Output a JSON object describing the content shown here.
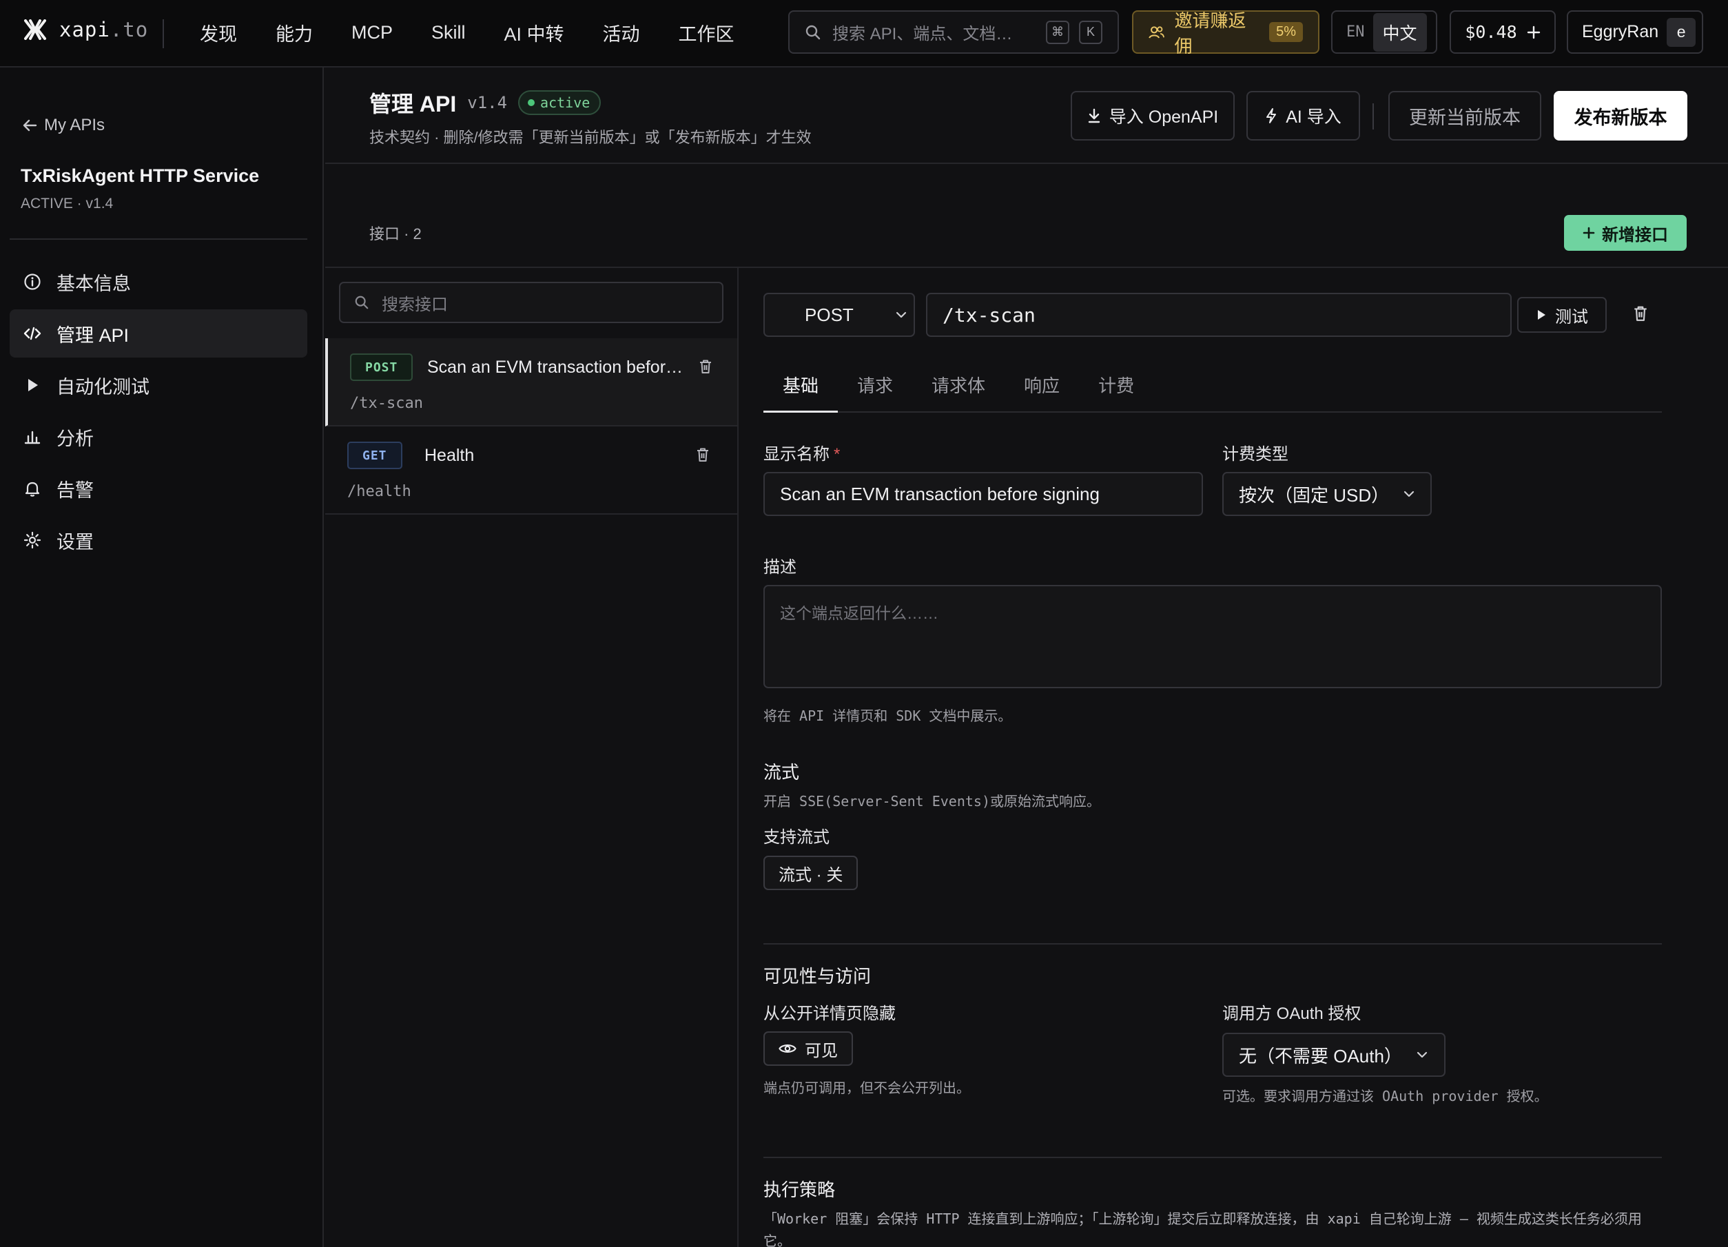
{
  "topbar": {
    "logo": "xapi",
    "logo_suffix": ".to",
    "nav": [
      "发现",
      "能力",
      "MCP",
      "Skill",
      "AI 中转",
      "活动",
      "工作区"
    ],
    "search_placeholder": "搜索 API、端点、文档…",
    "search_shortcut": [
      "⌘",
      "K"
    ],
    "invite_label": "邀请赚返佣",
    "invite_pct": "5%",
    "lang_en": "EN",
    "lang_zh": "中文",
    "balance": "$0.48",
    "username": "EggryRan",
    "avatar_letter": "e"
  },
  "sidebar": {
    "back_label": "My APIs",
    "service_name": "TxRiskAgent HTTP Service",
    "service_sub": "ACTIVE · v1.4",
    "items": [
      {
        "label": "基本信息",
        "icon": "info-icon"
      },
      {
        "label": "管理 API",
        "icon": "code-icon"
      },
      {
        "label": "自动化测试",
        "icon": "play-icon"
      },
      {
        "label": "分析",
        "icon": "bar-chart-icon"
      },
      {
        "label": "告警",
        "icon": "bell-icon"
      },
      {
        "label": "设置",
        "icon": "gear-icon"
      }
    ],
    "active_index": 1
  },
  "header": {
    "title": "管理 API",
    "version": "v1.4",
    "status": "active",
    "subtitle": "技术契约 · 删除/修改需「更新当前版本」或「发布新版本」才生效",
    "import_openapi": "导入 OpenAPI",
    "ai_import": "AI 导入",
    "update_current": "更新当前版本",
    "publish_new": "发布新版本"
  },
  "endpoints": {
    "count_label": "接口 · 2",
    "add_label": "新增接口",
    "search_placeholder": "搜索接口",
    "list": [
      {
        "method": "POST",
        "name": "Scan an EVM transaction before signing",
        "path": "/tx-scan"
      },
      {
        "method": "GET",
        "name": "Health",
        "path": "/health"
      }
    ],
    "selected_index": 0
  },
  "detail": {
    "method": "POST",
    "path": "/tx-scan",
    "test_label": "测试",
    "tabs": [
      "基础",
      "请求",
      "请求体",
      "响应",
      "计费"
    ],
    "active_tab": 0,
    "display_name_label": "显示名称",
    "required_mark": "*",
    "display_name_value": "Scan an EVM transaction before signing",
    "billing_type_label": "计费类型",
    "billing_type_value": "按次（固定 USD）",
    "description_label": "描述",
    "description_placeholder": "这个端点返回什么……",
    "description_hint": "将在 API 详情页和 SDK 文档中展示。",
    "stream_title": "流式",
    "stream_desc": "开启 SSE(Server-Sent Events)或原始流式响应。",
    "stream_support_label": "支持流式",
    "stream_toggle": "流式 · 关",
    "visibility_title": "可见性与访问",
    "hide_label": "从公开详情页隐藏",
    "visible_toggle": "可见",
    "hide_hint": "端点仍可调用，但不会公开列出。",
    "oauth_label": "调用方 OAuth 授权",
    "oauth_value": "无（不需要 OAuth）",
    "oauth_hint": "可选。要求调用方通过该 OAuth provider 授权。",
    "exec_title": "执行策略",
    "exec_desc": "「Worker 阻塞」会保持 HTTP 连接直到上游响应；「上游轮询」提交后立即释放连接，由 xapi 自己轮询上游 — 视频生成这类长任务必须用它。"
  }
}
